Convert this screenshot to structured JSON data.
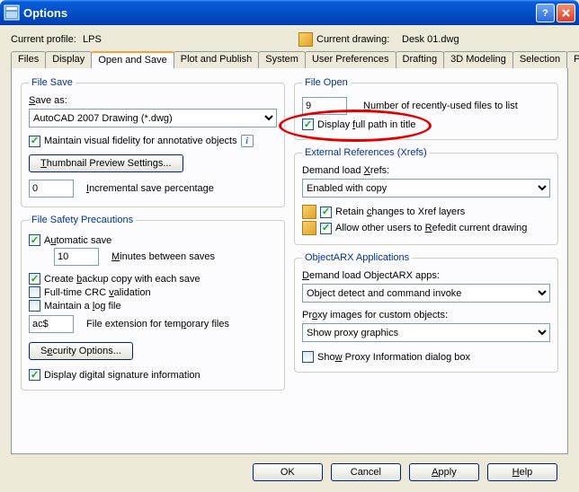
{
  "window": {
    "title": "Options"
  },
  "profile": {
    "current_label": "Current profile:",
    "current_value": "LPS",
    "drawing_label": "Current drawing:",
    "drawing_value": "Desk 01.dwg"
  },
  "tabs": [
    "Files",
    "Display",
    "Open and Save",
    "Plot and Publish",
    "System",
    "User Preferences",
    "Drafting",
    "3D Modeling",
    "Selection",
    "P"
  ],
  "active_tab": 2,
  "file_save": {
    "legend": "File Save",
    "save_as_label": "Save as:",
    "save_as_value": "AutoCAD 2007 Drawing (*.dwg)",
    "fidelity_label": "Maintain visual fidelity for annotative objects",
    "thumbnail_button": "Thumbnail Preview Settings...",
    "incr_value": "0",
    "incr_label": "Incremental save percentage"
  },
  "file_safety": {
    "legend": "File Safety Precautions",
    "auto_save": "Automatic save",
    "minutes_value": "10",
    "minutes_label": "Minutes between saves",
    "backup": "Create backup copy with each save",
    "crc": "Full-time CRC validation",
    "logfile": "Maintain a log file",
    "ext_value": "ac$",
    "ext_label": "File extension for temporary files",
    "security_button": "Security Options...",
    "signature": "Display digital signature information"
  },
  "file_open": {
    "legend": "File Open",
    "recent_value": "9",
    "recent_label": "Number of recently-used files to list",
    "fullpath": "Display full path in title"
  },
  "xrefs": {
    "legend": "External References (Xrefs)",
    "demand_label": "Demand load Xrefs:",
    "demand_value": "Enabled with copy",
    "retain": "Retain changes to Xref layers",
    "allow": "Allow other users to Refedit current drawing"
  },
  "arx": {
    "legend": "ObjectARX Applications",
    "demand_label": "Demand load ObjectARX apps:",
    "demand_value": "Object detect and command invoke",
    "proxy_label": "Proxy images for custom objects:",
    "proxy_value": "Show proxy graphics",
    "show_dialog": "Show Proxy Information dialog box"
  },
  "buttons": {
    "ok": "OK",
    "cancel": "Cancel",
    "apply": "Apply",
    "help": "Help"
  }
}
